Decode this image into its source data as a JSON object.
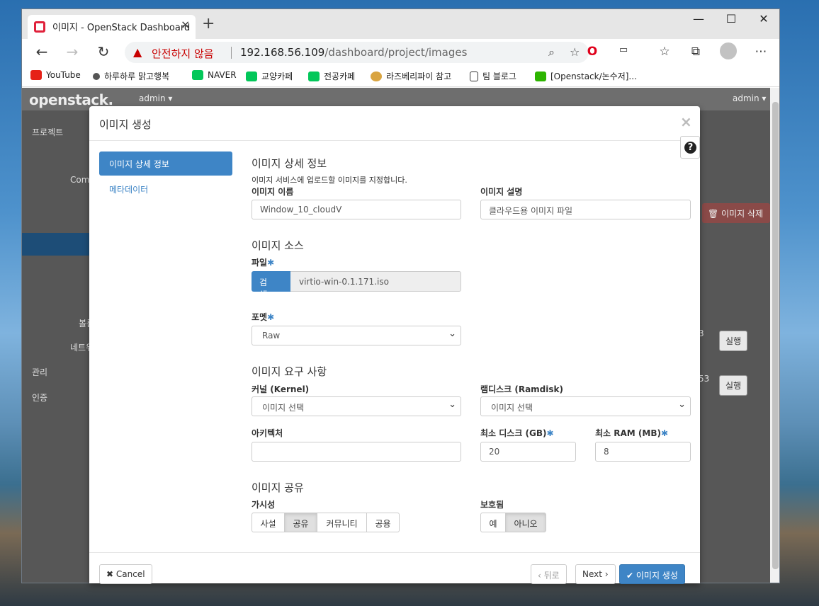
{
  "browser": {
    "tab_title": "이미지 - OpenStack Dashboard",
    "tab_close": "×",
    "new_tab": "+",
    "security_warning": "안전하지 않음",
    "url_host": "192.168.56.109",
    "url_path": "/dashboard/project/images",
    "bookmarks": [
      {
        "label": "YouTube",
        "icon": "youtube-icon",
        "color": "#e62117"
      },
      {
        "label": "하루하루 맑고행복",
        "icon": "dots-icon",
        "color": "#333333"
      },
      {
        "label": "NAVER",
        "icon": "naver-icon",
        "color": "#03c75a"
      },
      {
        "label": "교양카페",
        "icon": "cafe-icon",
        "color": "#03c75a"
      },
      {
        "label": "전공카페",
        "icon": "cafe-icon",
        "color": "#03c75a"
      },
      {
        "label": "라즈베리파이 참고",
        "icon": "raspberry-icon",
        "color": "#d9a441"
      },
      {
        "label": "팀 블로그",
        "icon": "page-icon",
        "color": "#ffffff"
      },
      {
        "label": "[Openstack/논수저]...",
        "icon": "blog-icon",
        "color": "#2db400"
      }
    ]
  },
  "dashboard": {
    "logo": "openstack.",
    "project_menu": "admin ▾",
    "user_menu": "admin ▾",
    "sidebar": {
      "project": "프로젝트",
      "compute": "Comp",
      "volume": "볼륨",
      "network": "네트워",
      "admin": "관리",
      "identity": "인증"
    },
    "delete_images_btn": "🗑 이미지 삭제",
    "row_action": "실행",
    "row_value_1": "3",
    "row_value_2": "53"
  },
  "modal": {
    "title": "이미지 생성",
    "close": "×",
    "help": "?",
    "wizard_steps": [
      "이미지 상세 정보",
      "메타데이터"
    ],
    "details": {
      "title": "이미지 상세 정보",
      "description": "이미지 서비스에 업로드할 이미지를 지정합니다.",
      "name_label": "이미지 이름",
      "name_value": "Window_10_cloudV",
      "desc_label": "이미지 설명",
      "desc_value": "클라우드용 이미지 파일"
    },
    "source": {
      "title": "이미지 소스",
      "file_label": "파일",
      "browse_button": "검색...",
      "file_name": "virtio-win-0.1.171.iso",
      "format_label": "포멧",
      "format_value": "Raw"
    },
    "requirements": {
      "title": "이미지 요구 사항",
      "kernel_label": "커널 (Kernel)",
      "kernel_value": "이미지 선택",
      "ramdisk_label": "램디스크 (Ramdisk)",
      "ramdisk_value": "이미지 선택",
      "arch_label": "아키텍처",
      "arch_value": "",
      "min_disk_label": "최소 디스크 (GB)",
      "min_disk_value": "20",
      "min_ram_label": "최소 RAM (MB)",
      "min_ram_value": "8"
    },
    "sharing": {
      "title": "이미지 공유",
      "visibility_label": "가시성",
      "visibility_options": [
        "사설",
        "공유",
        "커뮤니티",
        "공용"
      ],
      "visibility_selected": "공유",
      "protected_label": "보호됨",
      "protected_options": [
        "예",
        "아니오"
      ],
      "protected_selected": "아니오"
    },
    "footer": {
      "cancel": "Cancel",
      "back": "‹ 뒤로",
      "next": "Next ›",
      "create": "이미지 생성"
    }
  },
  "colors": {
    "accent": "#3e85c6",
    "warning": "#c80000"
  }
}
